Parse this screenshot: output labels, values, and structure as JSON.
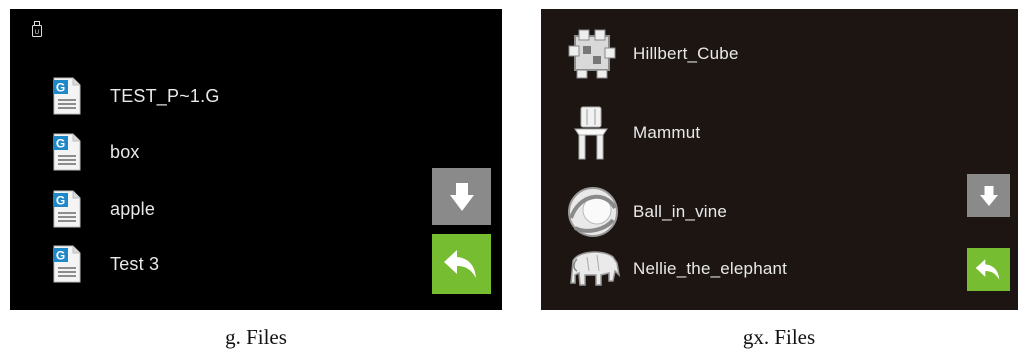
{
  "screens": {
    "g": {
      "storage_icon": "usb-drive-icon",
      "files": [
        {
          "name": "TEST_P~1.G",
          "icon": "gcode-file-icon"
        },
        {
          "name": "box",
          "icon": "gcode-file-icon"
        },
        {
          "name": "apple",
          "icon": "gcode-file-icon"
        },
        {
          "name": "Test 3",
          "icon": "gcode-file-icon"
        }
      ],
      "buttons": {
        "down_icon": "arrow-down-icon",
        "back_icon": "back-arrow-icon"
      },
      "caption": "g. Files"
    },
    "gx": {
      "files": [
        {
          "name": "Hillbert_Cube",
          "icon": "model-thumbnail-cube"
        },
        {
          "name": "Mammut",
          "icon": "model-thumbnail-chair"
        },
        {
          "name": "Ball_in_vine",
          "icon": "model-thumbnail-ball"
        },
        {
          "name": "Nellie_the_elephant",
          "icon": "model-thumbnail-elephant"
        }
      ],
      "buttons": {
        "down_icon": "arrow-down-icon",
        "back_icon": "back-arrow-icon"
      },
      "caption": "gx. Files"
    }
  },
  "colors": {
    "screen_bg_g": "#000000",
    "screen_bg_gx": "#1d1512",
    "down_button": "#8a8a8a",
    "back_button": "#77bd31",
    "text": "#e9e9e9",
    "file_icon_blue": "#1e88c8"
  }
}
